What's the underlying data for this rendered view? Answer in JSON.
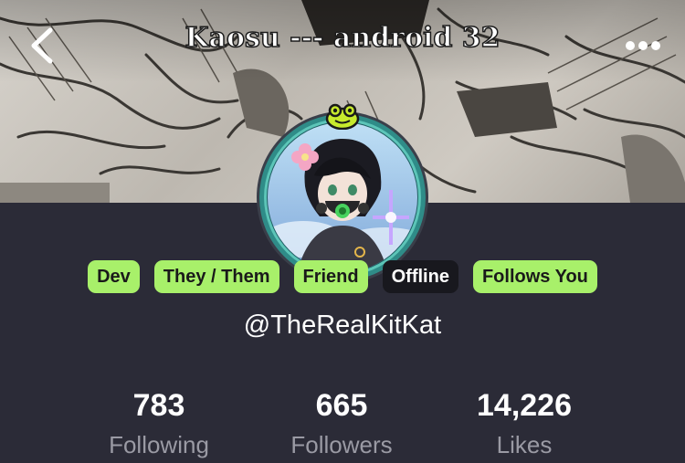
{
  "header": {
    "title": "Kaosu --- android 32",
    "back_icon": "chevron-left-icon",
    "more_icon": "more-horizontal-icon"
  },
  "profile": {
    "avatar_badge_icon": "frog-icon",
    "tags": [
      {
        "label": "Dev",
        "color": "#a8f06a"
      },
      {
        "label": "They / Them",
        "color": "#a8f06a"
      },
      {
        "label": "Friend",
        "color": "#a8f06a"
      },
      {
        "label": "Offline",
        "color": "#18181e"
      },
      {
        "label": "Follows You",
        "color": "#a8f06a"
      }
    ],
    "handle": "@TheRealKitKat"
  },
  "stats": [
    {
      "value": "783",
      "label": "Following"
    },
    {
      "value": "665",
      "label": "Followers"
    },
    {
      "value": "14,226",
      "label": "Likes"
    }
  ],
  "colors": {
    "background": "#2b2b37",
    "tag_accent": "#a8f06a",
    "avatar_ring": "#3aa6a0"
  }
}
